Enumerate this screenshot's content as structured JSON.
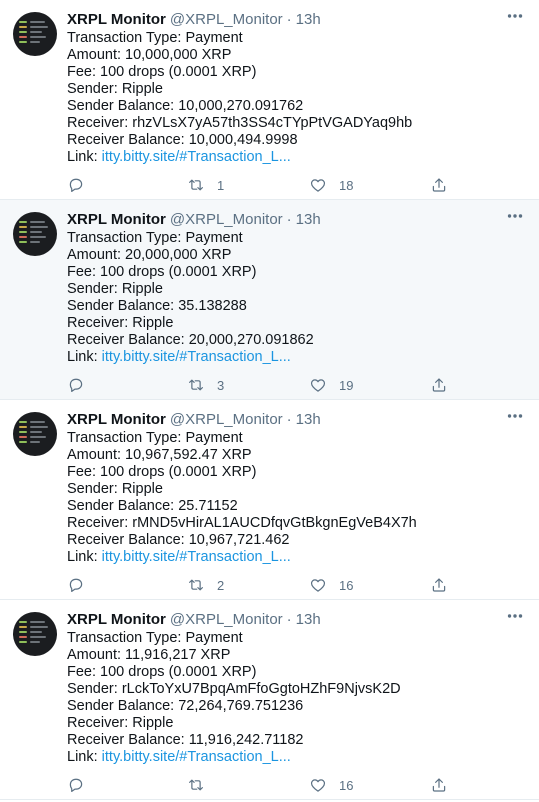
{
  "colors": {
    "link": "#1b95e0",
    "meta": "#5b7083",
    "hover_bg": "#f5f8fa"
  },
  "icons": {
    "reply": "speech-bubble-icon",
    "retweet": "retweet-icon",
    "like": "heart-icon",
    "share": "share-upload-icon",
    "more": "ellipsis-icon"
  },
  "tweets": [
    {
      "name": "XRPL Monitor",
      "handle": "@XRPL_Monitor",
      "dot": "·",
      "time": "13h",
      "lines": [
        "Transaction Type: Payment",
        "Amount: 10,000,000 XRP",
        "Fee: 100 drops (0.0001 XRP)",
        "Sender: Ripple",
        "Sender Balance: 10,000,270.091762",
        "Receiver: rhzVLsX7yA57th3SS4cTYpPtVGADYaq9hb",
        "Receiver Balance: 10,000,494.9998"
      ],
      "link_label": "Link: ",
      "link_text": "itty.bitty.site/#Transaction_L...",
      "reply_count": "",
      "retweet_count": "1",
      "like_count": "18"
    },
    {
      "name": "XRPL Monitor",
      "handle": "@XRPL_Monitor",
      "dot": "·",
      "time": "13h",
      "lines": [
        "Transaction Type: Payment",
        "Amount: 20,000,000 XRP",
        "Fee: 100 drops (0.0001 XRP)",
        "Sender: Ripple",
        "Sender Balance: 35.138288",
        "Receiver: Ripple",
        "Receiver Balance: 20,000,270.091862"
      ],
      "link_label": "Link: ",
      "link_text": "itty.bitty.site/#Transaction_L...",
      "reply_count": "",
      "retweet_count": "3",
      "like_count": "19"
    },
    {
      "name": "XRPL Monitor",
      "handle": "@XRPL_Monitor",
      "dot": "·",
      "time": "13h",
      "lines": [
        "Transaction Type: Payment",
        "Amount: 10,967,592.47 XRP",
        "Fee: 100 drops (0.0001 XRP)",
        "Sender: Ripple",
        "Sender Balance: 25.71152",
        "Receiver: rMND5vHirAL1AUCDfqvGtBkgnEgVeB4X7h",
        "Receiver Balance: 10,967,721.462"
      ],
      "link_label": "Link: ",
      "link_text": "itty.bitty.site/#Transaction_L...",
      "reply_count": "",
      "retweet_count": "2",
      "like_count": "16"
    },
    {
      "name": "XRPL Monitor",
      "handle": "@XRPL_Monitor",
      "dot": "·",
      "time": "13h",
      "lines": [
        "Transaction Type: Payment",
        "Amount: 11,916,217 XRP",
        "Fee: 100 drops (0.0001 XRP)",
        "Sender: rLckToYxU7BpqAmFfoGgtoHZhF9NjvsK2D",
        "Sender Balance: 72,264,769.751236",
        "Receiver: Ripple",
        "Receiver Balance: 11,916,242.71182"
      ],
      "link_label": "Link: ",
      "link_text": "itty.bitty.site/#Transaction_L...",
      "reply_count": "",
      "retweet_count": "",
      "like_count": "16"
    }
  ]
}
